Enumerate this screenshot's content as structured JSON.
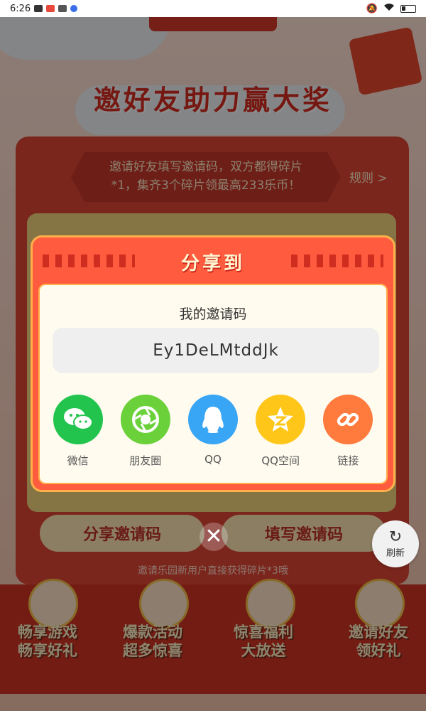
{
  "status_bar": {
    "time": "6:26",
    "left_icons": [
      "video-icon",
      "app-icon",
      "calendar-icon",
      "browser-icon"
    ],
    "right_icons": [
      "mute-icon",
      "wifi-icon",
      "battery-icon"
    ]
  },
  "page": {
    "title": "邀好友助力赢大奖",
    "banner_text_line1": "邀请好友填写邀请码，双方都得碎片",
    "banner_text_line2": "*1，集齐3个碎片领最高233乐币！",
    "rules_link": "规则 >",
    "share_invite_button": "分享邀请码",
    "fill_invite_button": "填写邀请码",
    "invite_note": "邀请乐园新用户直接获得碎片*3哦",
    "features": [
      {
        "line1": "畅享游戏",
        "line2": "畅享好礼"
      },
      {
        "line1": "爆款活动",
        "line2": "超多惊喜"
      },
      {
        "line1": "惊喜福利",
        "line2": "大放送"
      },
      {
        "line1": "邀请好友",
        "line2": "领好礼"
      }
    ]
  },
  "refresh_button": {
    "label": "刷新",
    "icon": "refresh-icon"
  },
  "share_dialog": {
    "title": "分享到",
    "code_label": "我的邀请码",
    "invite_code": "Ey1DeLMtddJk",
    "targets": [
      {
        "label": "微信",
        "icon": "wechat-icon",
        "color": "#22c44e"
      },
      {
        "label": "朋友圈",
        "icon": "moments-icon",
        "color": "#6bd13b"
      },
      {
        "label": "QQ",
        "icon": "qq-icon",
        "color": "#39a6f5"
      },
      {
        "label": "QQ空间",
        "icon": "qzone-icon",
        "color": "#ffc61a"
      },
      {
        "label": "链接",
        "icon": "link-icon",
        "color": "#ff7a3d"
      }
    ],
    "close_icon": "close-icon"
  }
}
